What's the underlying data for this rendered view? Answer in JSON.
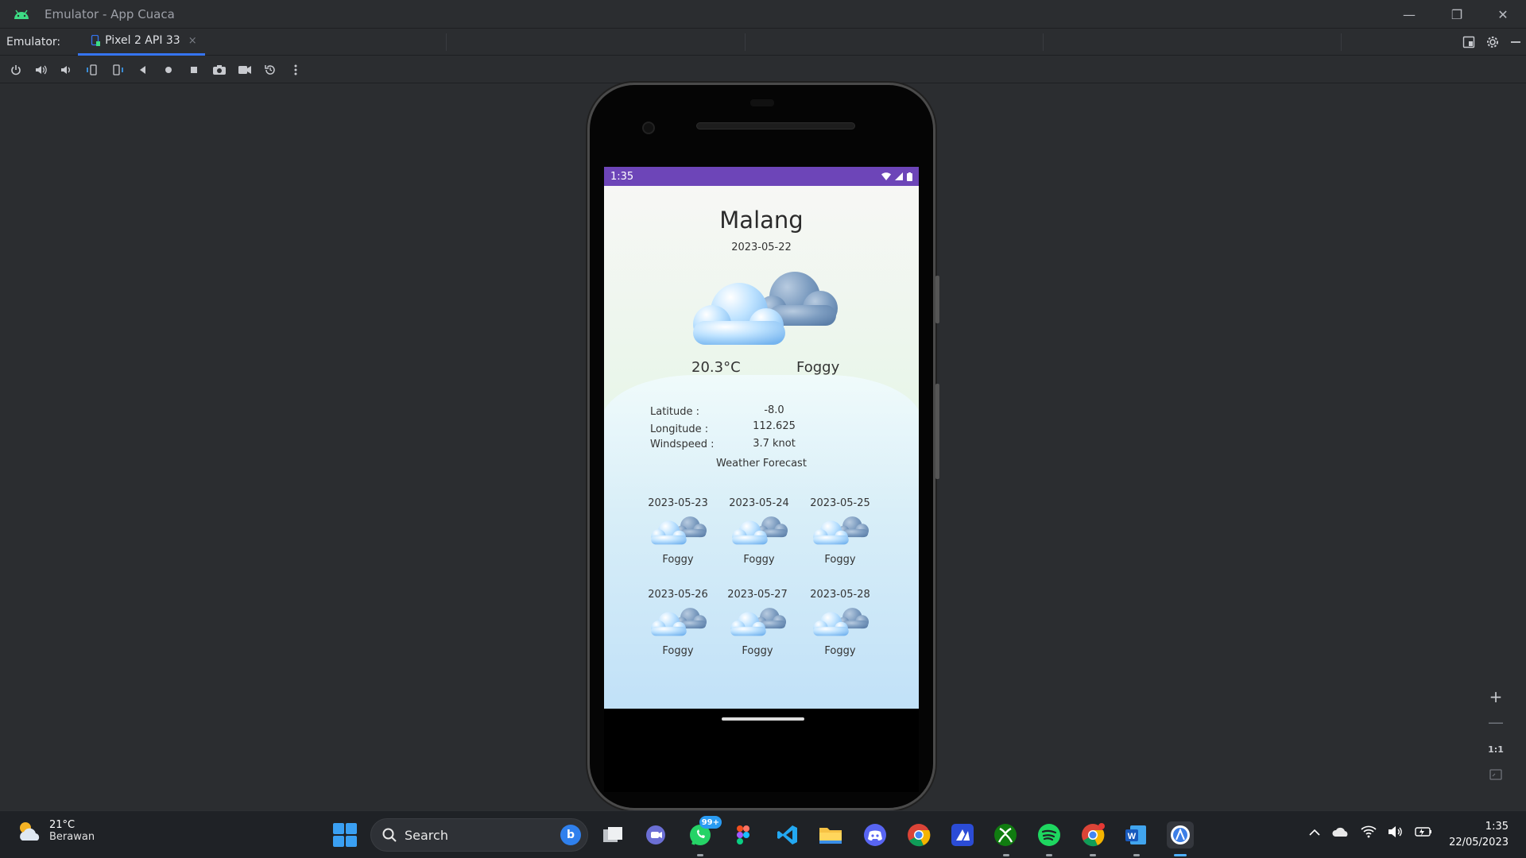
{
  "window": {
    "title": "Emulator - App Cuaca",
    "minimize": "—",
    "restore": "❐",
    "close": "✕"
  },
  "emulator_tabs": {
    "label": "Emulator:",
    "active_tab": "Pixel 2 API 33",
    "close": "×"
  },
  "device": {
    "status_time": "1:35"
  },
  "weather_app": {
    "city": "Malang",
    "date": "2023-05-22",
    "temperature": "20.3°C",
    "condition": "Foggy",
    "latitude_label": "Latitude      :",
    "latitude_value": "-8.0",
    "longitude_label": "Longitude   :",
    "longitude_value": "112.625",
    "windspeed_label": "Windspeed :",
    "windspeed_value": "3.7 knot",
    "forecast_title": "Weather Forecast",
    "forecast": [
      {
        "date": "2023-05-23",
        "condition": "Foggy"
      },
      {
        "date": "2023-05-24",
        "condition": "Foggy"
      },
      {
        "date": "2023-05-25",
        "condition": "Foggy"
      },
      {
        "date": "2023-05-26",
        "condition": "Foggy"
      },
      {
        "date": "2023-05-27",
        "condition": "Foggy"
      },
      {
        "date": "2023-05-28",
        "condition": "Foggy"
      }
    ]
  },
  "zoom_controls": {
    "zoom_in": "+",
    "zoom_out": "—",
    "one_to_one": "1:1"
  },
  "taskbar": {
    "weather_temp": "21°C",
    "weather_desc": "Berawan",
    "search_placeholder": "Search",
    "whatsapp_badge": "99+",
    "chrome_badge": "",
    "time": "1:35",
    "date": "22/05/2023"
  },
  "colors": {
    "status_bar": "#6d45b8",
    "accent": "#3574f0"
  }
}
